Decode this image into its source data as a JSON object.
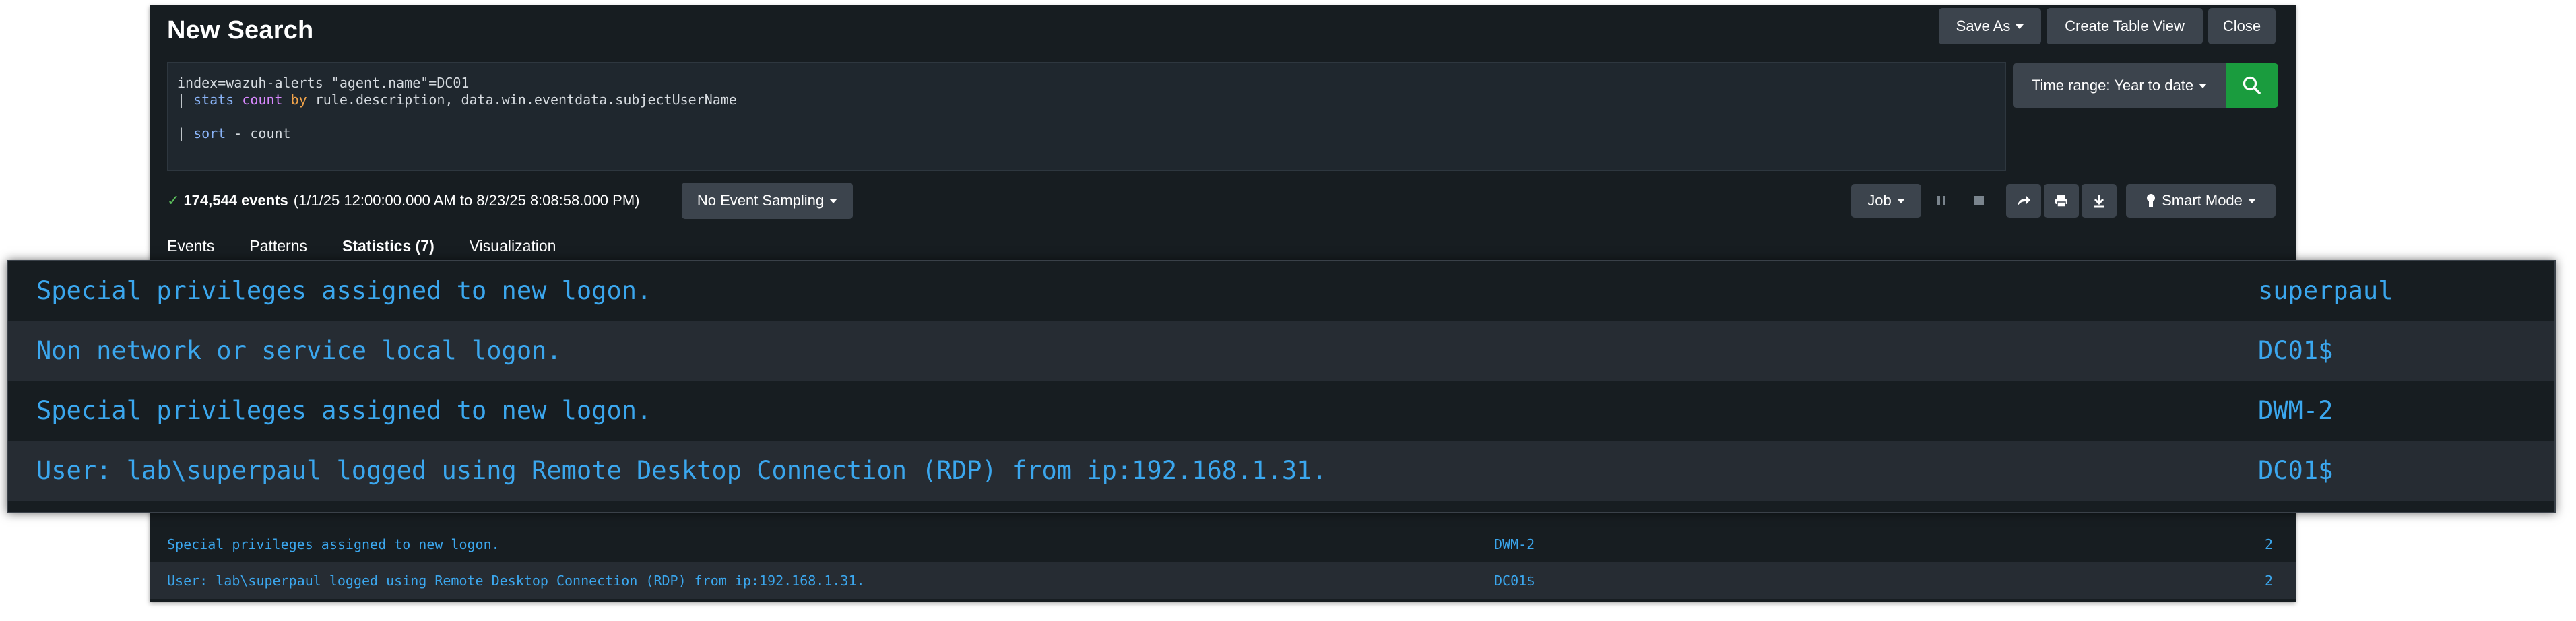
{
  "header": {
    "title": "New Search",
    "save_as": "Save As",
    "create_table_view": "Create Table View",
    "close": "Close"
  },
  "query": {
    "line1": "index=wazuh-alerts \"agent.name\"=DC01",
    "line2_pipe": "| ",
    "line2_cmd": "stats",
    "line2_fn": "count",
    "line2_by": "by",
    "line2_rest": " rule.description, data.win.eventdata.subjectUserName",
    "line4_pipe": "| ",
    "line4_cmd": "sort",
    "line4_rest": " - count"
  },
  "time_range": {
    "label": "Time range: Year to date"
  },
  "status": {
    "events": "174,544 events",
    "range": "(1/1/25 12:00:00.000 AM to 8/23/25 8:08:58.000 PM)",
    "sampling": "No Event Sampling"
  },
  "job": {
    "label": "Job",
    "smart_mode": "Smart Mode"
  },
  "tabs": [
    {
      "label": "Events"
    },
    {
      "label": "Patterns"
    },
    {
      "label": "Statistics (7)"
    },
    {
      "label": "Visualization"
    }
  ],
  "zoom_rows": [
    {
      "description": "Special privileges assigned to new logon.",
      "user": "superpaul"
    },
    {
      "description": "Non network or service local logon.",
      "user": "DC01$"
    },
    {
      "description": "Special privileges assigned to new logon.",
      "user": "DWM-2"
    },
    {
      "description": "User: lab\\superpaul logged using Remote Desktop Connection (RDP) from ip:192.168.1.31.",
      "user": "DC01$"
    }
  ],
  "table_rows": [
    {
      "description": "Special privileges assigned to new logon.",
      "user": "DWM-2",
      "count": "2"
    },
    {
      "description": "User: lab\\superpaul logged using Remote Desktop Connection (RDP) from ip:192.168.1.31.",
      "user": "DC01$",
      "count": "2"
    }
  ],
  "colors": {
    "background": "#171d21",
    "alt_row": "#262c33",
    "link_blue": "#3ba7ee",
    "search_green": "#1a9c3e",
    "button": "#3c444d"
  },
  "icons": {
    "search": "search-icon",
    "pause": "pause-icon",
    "stop": "stop-icon",
    "share": "share-icon",
    "print": "print-icon",
    "export": "download-icon",
    "smart_mode": "lightbulb-icon",
    "check": "checkmark-icon"
  }
}
